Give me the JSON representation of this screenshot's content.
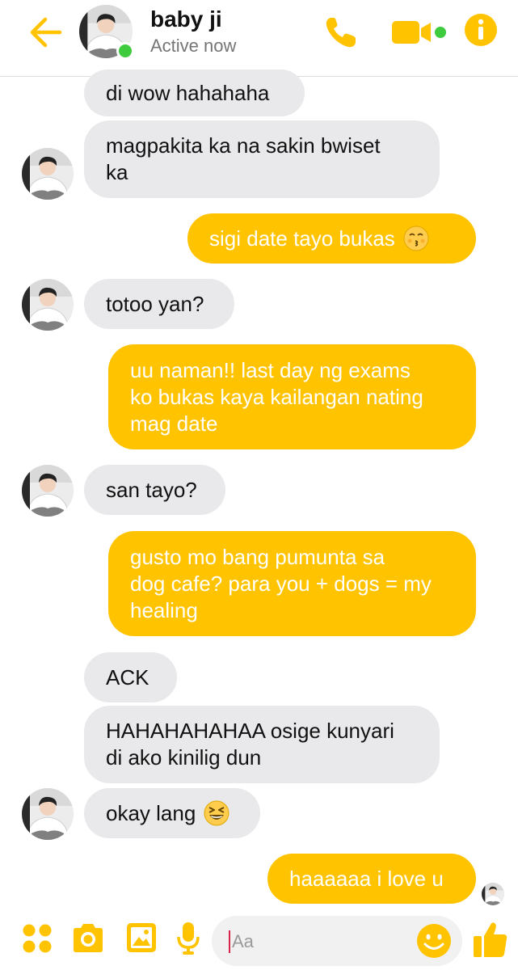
{
  "header": {
    "back_icon": "arrow-left-icon",
    "contact_name": "baby ji",
    "status": "Active now",
    "online": true,
    "actions": [
      "phone-icon",
      "video-camera-icon",
      "info-icon"
    ]
  },
  "colors": {
    "accent": "#ffc300",
    "incoming_bubble": "#e9e9eb",
    "online": "#3ecb3e",
    "caret": "#d8254c"
  },
  "messages": [
    {
      "from": "them",
      "lines": [
        "di wow hahahaha"
      ]
    },
    {
      "from": "them",
      "lines": [
        "magpakita ka na sakin bwiset",
        "ka"
      ]
    },
    {
      "from": "me",
      "lines": [
        "sigi date tayo bukas"
      ],
      "emoji": "kissing-face-icon"
    },
    {
      "from": "them",
      "lines": [
        "totoo yan?"
      ]
    },
    {
      "from": "me",
      "lines": [
        "uu naman!! last day ng exams",
        "ko bukas kaya kailangan nating",
        "mag date"
      ]
    },
    {
      "from": "them",
      "lines": [
        "san tayo?"
      ]
    },
    {
      "from": "me",
      "lines": [
        "gusto mo bang pumunta sa",
        "dog cafe? para you + dogs = my",
        "healing"
      ]
    },
    {
      "from": "them",
      "lines": [
        "ACK"
      ]
    },
    {
      "from": "them",
      "lines": [
        "HAHAHAHAHAA osige kunyari",
        "di ako kinilig dun"
      ]
    },
    {
      "from": "them",
      "lines": [
        "okay lang"
      ],
      "emoji": "grinning-squinting-face-icon"
    },
    {
      "from": "me",
      "lines": [
        "haaaaaa i love u"
      ],
      "seen": true
    }
  ],
  "composer": {
    "placeholder": "Aa",
    "actions": [
      "more-apps-icon",
      "camera-icon",
      "gallery-icon",
      "microphone-icon"
    ],
    "emoji_icon": "smiley-face-icon",
    "send_icon": "thumbs-up-icon"
  }
}
